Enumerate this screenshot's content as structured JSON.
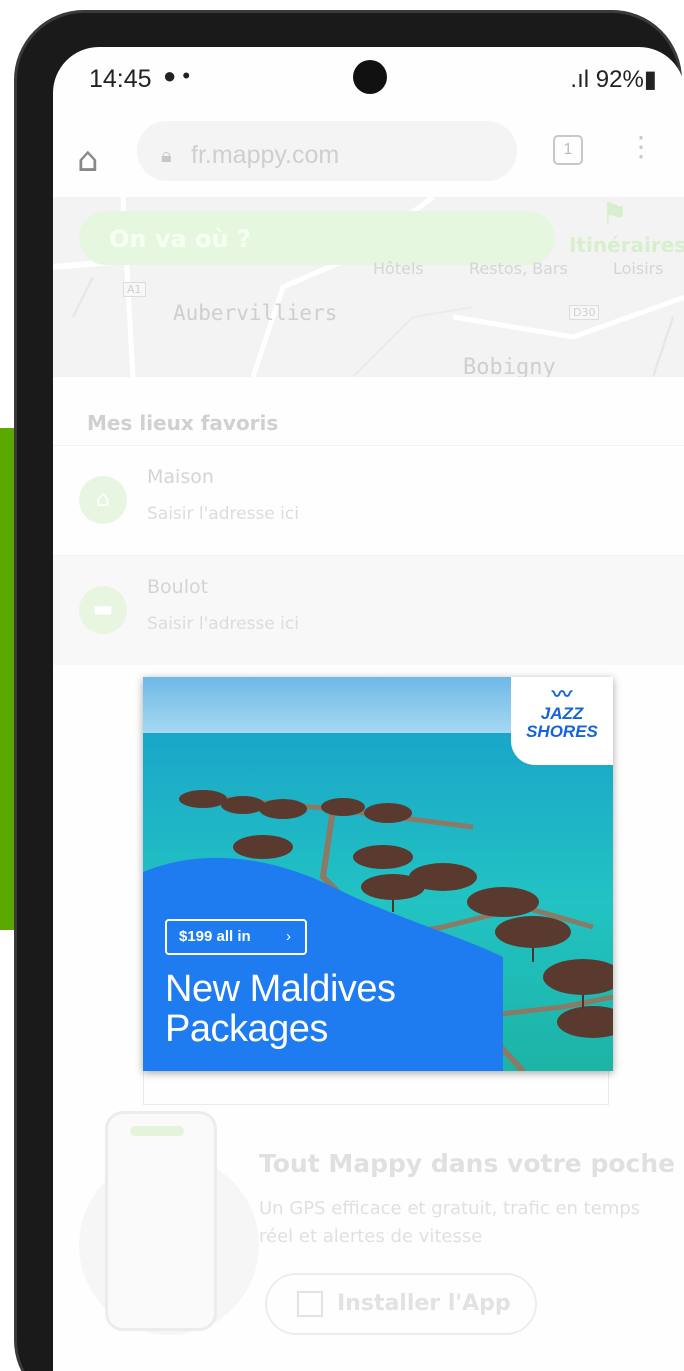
{
  "status_bar": {
    "time": "14:45",
    "notification_icons": "● •",
    "signal_battery": ".ıl 92%▮"
  },
  "browser": {
    "url": "fr.mappy.com",
    "tabs_count": "1"
  },
  "map": {
    "search_placeholder": "On va où ?",
    "itineraires_label": "Itinéraires",
    "categories": [
      "Hôtels",
      "Restos, Bars",
      "Loisirs"
    ],
    "place_aubervilliers": "Aubervilliers",
    "place_bobigny": "Bobigny",
    "road_a1": "A1",
    "road_d30": "D30"
  },
  "favorites": {
    "title": "Mes lieux favoris",
    "items": [
      {
        "name": "Maison",
        "placeholder": "Saisir l'adresse ici",
        "icon": "home-icon"
      },
      {
        "name": "Boulot",
        "placeholder": "Saisir l'adresse ici",
        "icon": "briefcase-icon"
      }
    ]
  },
  "ad": {
    "brand": "JAZZ SHORES",
    "brand_line1": "JAZZ",
    "brand_line2": "SHORES",
    "cta": "$199 all in",
    "headline_line1": "New Maldives",
    "headline_line2": "Packages",
    "colors": {
      "blue": "#1e7cf0",
      "sea": "#2fc9c5"
    }
  },
  "promo": {
    "title": "Tout Mappy dans votre poche",
    "text": "Un GPS efficace et gratuit, trafic en temps réel et alertes de vitesse",
    "install_label": "Installer l'App"
  },
  "colors": {
    "mappy_green": "#5aa800"
  }
}
